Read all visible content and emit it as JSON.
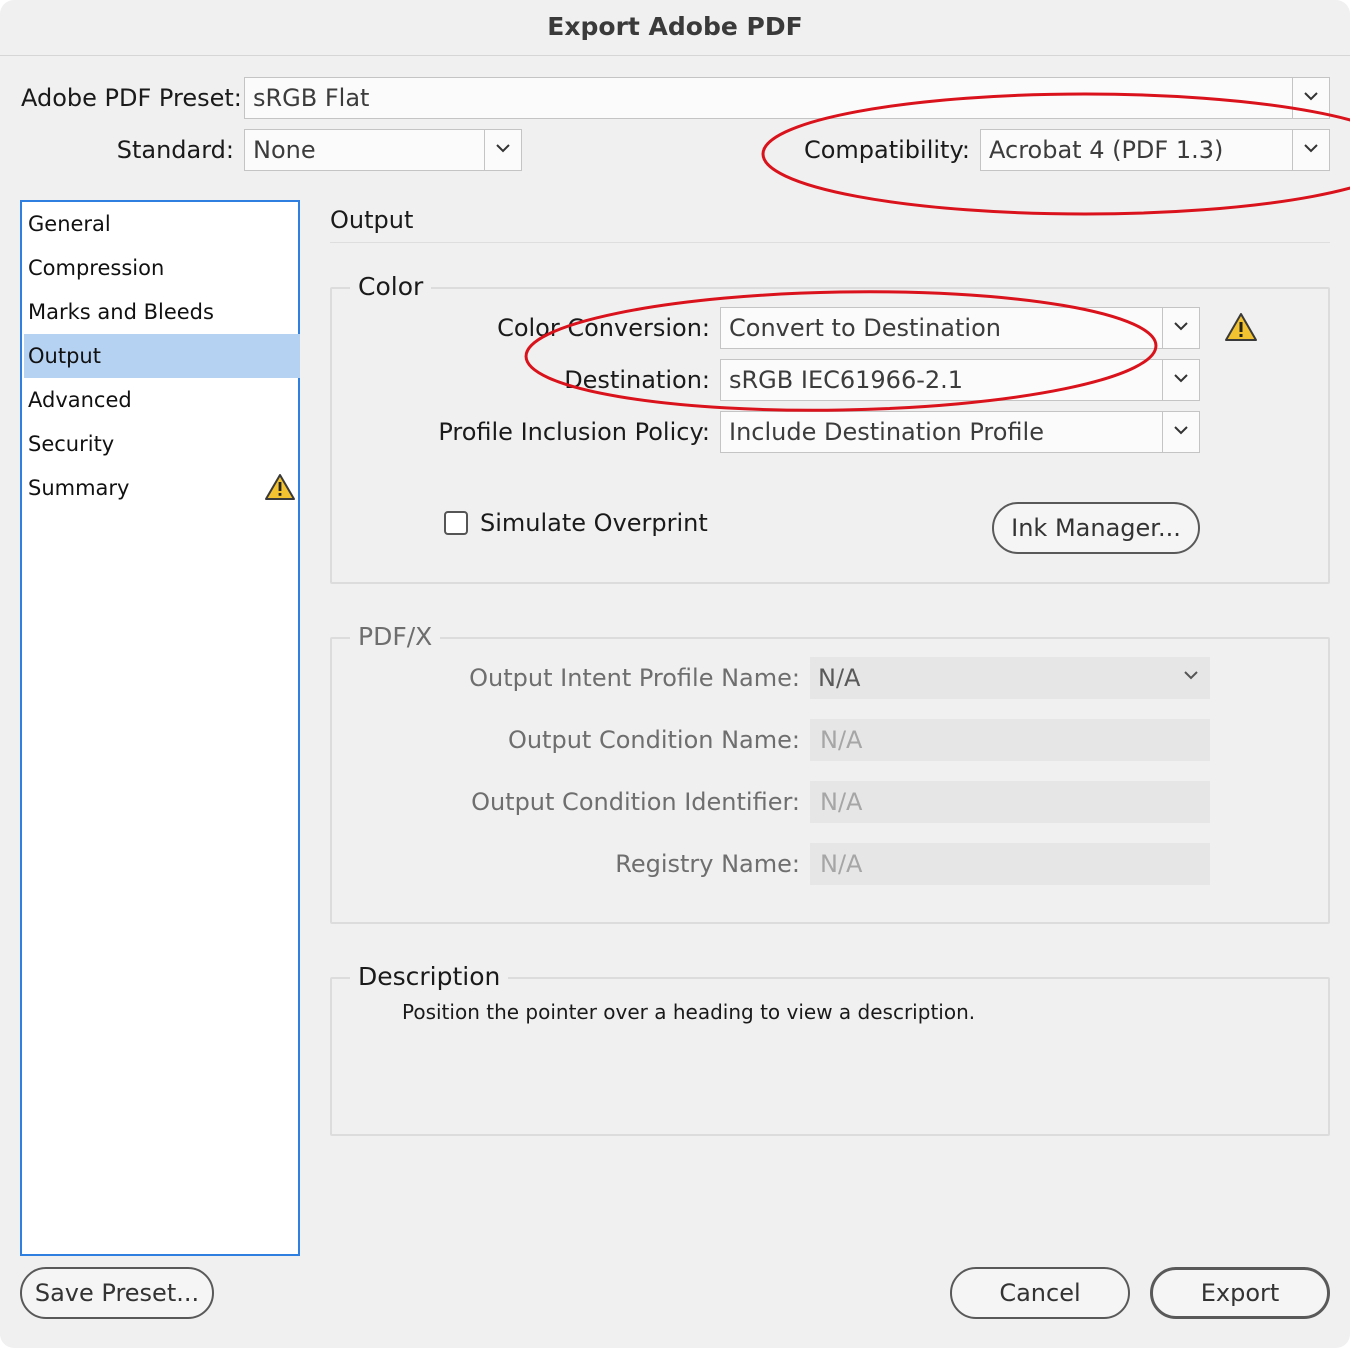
{
  "window": {
    "title": "Export Adobe PDF"
  },
  "header": {
    "preset_label": "Adobe PDF Preset:",
    "preset_value": "sRGB Flat",
    "standard_label": "Standard:",
    "standard_value": "None",
    "compatibility_label": "Compatibility:",
    "compatibility_value": "Acrobat 4 (PDF 1.3)"
  },
  "sidebar": {
    "items": [
      {
        "label": "General"
      },
      {
        "label": "Compression"
      },
      {
        "label": "Marks and Bleeds"
      },
      {
        "label": "Output",
        "selected": true
      },
      {
        "label": "Advanced"
      },
      {
        "label": "Security"
      },
      {
        "label": "Summary",
        "warning": true
      }
    ]
  },
  "main": {
    "section_title": "Output",
    "color": {
      "legend": "Color",
      "conversion_label": "Color Conversion:",
      "conversion_value": "Convert to Destination",
      "destination_label": "Destination:",
      "destination_value": "sRGB IEC61966-2.1",
      "policy_label": "Profile Inclusion Policy:",
      "policy_value": "Include Destination Profile",
      "simulate_label": "Simulate Overprint",
      "simulate_checked": false,
      "ink_manager_label": "Ink Manager..."
    },
    "pdfx": {
      "legend": "PDF/X",
      "intent_label": "Output Intent Profile Name:",
      "intent_value": "N/A",
      "condition_label": "Output Condition Name:",
      "condition_value": "N/A",
      "identifier_label": "Output Condition Identifier:",
      "identifier_value": "N/A",
      "registry_label": "Registry Name:",
      "registry_value": "N/A"
    },
    "description": {
      "legend": "Description",
      "text": "Position the pointer over a heading to view a description."
    }
  },
  "footer": {
    "save_preset_label": "Save Preset...",
    "cancel_label": "Cancel",
    "export_label": "Export"
  },
  "colors": {
    "accent": "#2f7fe0",
    "selection": "#b6d2f2",
    "annotation": "#d9121b",
    "warning": "#f2c230"
  }
}
